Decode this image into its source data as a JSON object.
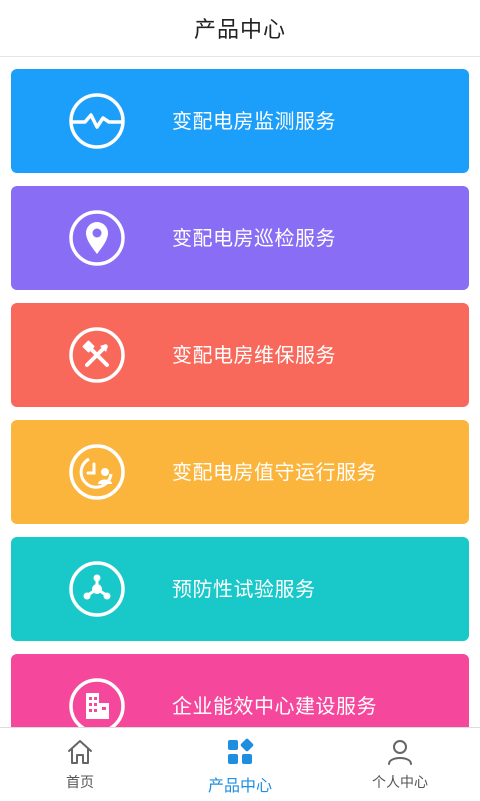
{
  "header": {
    "title": "产品中心"
  },
  "cards": [
    {
      "label": "变配电房监测服务",
      "color": "#1c9ffb",
      "icon": "monitor-wave-icon"
    },
    {
      "label": "变配电房巡检服务",
      "color": "#8a6df5",
      "icon": "location-pin-icon"
    },
    {
      "label": "变配电房维保服务",
      "color": "#f8695c",
      "icon": "tools-icon"
    },
    {
      "label": "变配电房值守运行服务",
      "color": "#fbb53d",
      "icon": "duty-clock-person-icon"
    },
    {
      "label": "预防性试验服务",
      "color": "#19c8c8",
      "icon": "share-network-icon"
    },
    {
      "label": "企业能效中心建设服务",
      "color": "#f5479c",
      "icon": "building-icon"
    }
  ],
  "tabbar": {
    "tabs": [
      {
        "label": "首页",
        "icon": "home-icon",
        "active": false
      },
      {
        "label": "产品中心",
        "icon": "grid-icon",
        "active": true
      },
      {
        "label": "个人中心",
        "icon": "person-icon",
        "active": false
      }
    ],
    "active_color": "#1f8ee0"
  }
}
